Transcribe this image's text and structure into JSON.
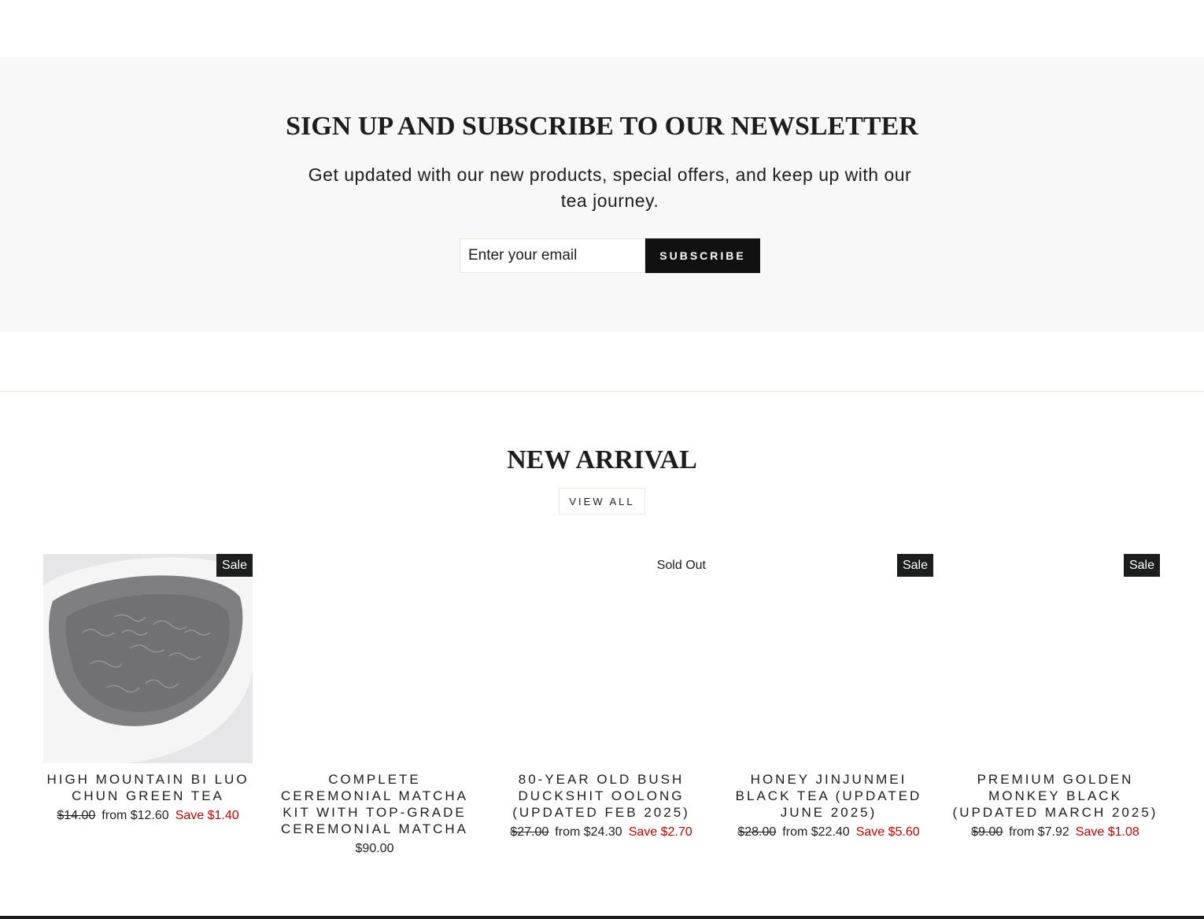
{
  "newsletter": {
    "title": "SIGN UP AND SUBSCRIBE TO OUR NEWSLETTER",
    "subtitle": "Get updated with our new products, special offers, and keep up with our tea journey.",
    "email_placeholder": "Enter your email",
    "subscribe_label": "SUBSCRIBE"
  },
  "new_arrival": {
    "title": "NEW ARRIVAL",
    "view_all_label": "VIEW ALL",
    "products": [
      {
        "title": "HIGH MOUNTAIN BI LUO CHUN GREEN TEA",
        "badge": "Sale",
        "old_price": "$14.00",
        "price": "from $12.60",
        "save": "Save $1.40"
      },
      {
        "title": "COMPLETE CEREMONIAL MATCHA KIT WITH TOP-GRADE CEREMONIAL MATCHA",
        "badge": "",
        "old_price": "",
        "price": "$90.00",
        "save": ""
      },
      {
        "title": "80-YEAR OLD BUSH DUCKSHIT OOLONG (UPDATED FEB 2025)",
        "badge": "Sold Out",
        "old_price": "$27.00",
        "price": "from $24.30",
        "save": "Save $2.70"
      },
      {
        "title": "HONEY JINJUNMEI BLACK TEA (UPDATED JUNE 2025)",
        "badge": "Sale",
        "old_price": "$28.00",
        "price": "from $22.40",
        "save": "Save $5.60"
      },
      {
        "title": "PREMIUM GOLDEN MONKEY BLACK (UPDATED MARCH 2025)",
        "badge": "Sale",
        "old_price": "$9.00",
        "price": "from $7.92",
        "save": "Save $1.08"
      }
    ]
  },
  "colors": {
    "sale_red": "#c20000",
    "badge_bg": "#1c1d1d",
    "newsletter_bg": "#f8f8f8"
  }
}
